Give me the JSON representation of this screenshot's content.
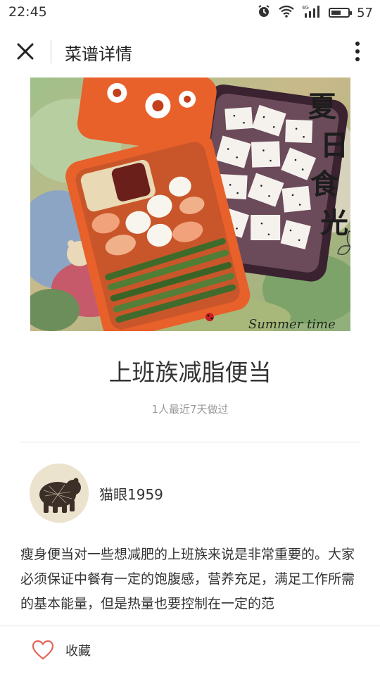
{
  "status_bar": {
    "time": "22:45",
    "battery": "57",
    "battery_level": 0.57,
    "network": "4G",
    "icons": [
      "alarm-icon",
      "wifi-icon",
      "signal-icon",
      "battery-icon"
    ]
  },
  "header": {
    "title": "菜谱详情",
    "close_icon": "close-icon",
    "more_icon": "more-vertical-icon"
  },
  "hero": {
    "overlay_title": "夏日食光",
    "overlay_caption": "Summer time"
  },
  "recipe": {
    "title": "上班族减脂便当",
    "stats": "1人最近7天做过",
    "description": "瘦身便当对一些想减肥的上班族来说是非常重要的。大家必须保证中餐有一定的饱腹感，营养充足，满足工作所需的基本能量，但是热量也要控制在一定的范"
  },
  "author": {
    "name": "猫眼1959"
  },
  "bottom_bar": {
    "favorite_label": "收藏",
    "favorite_icon": "heart-icon"
  },
  "colors": {
    "accent": "#e4635a",
    "text": "#333333",
    "muted": "#9a9a9a"
  }
}
